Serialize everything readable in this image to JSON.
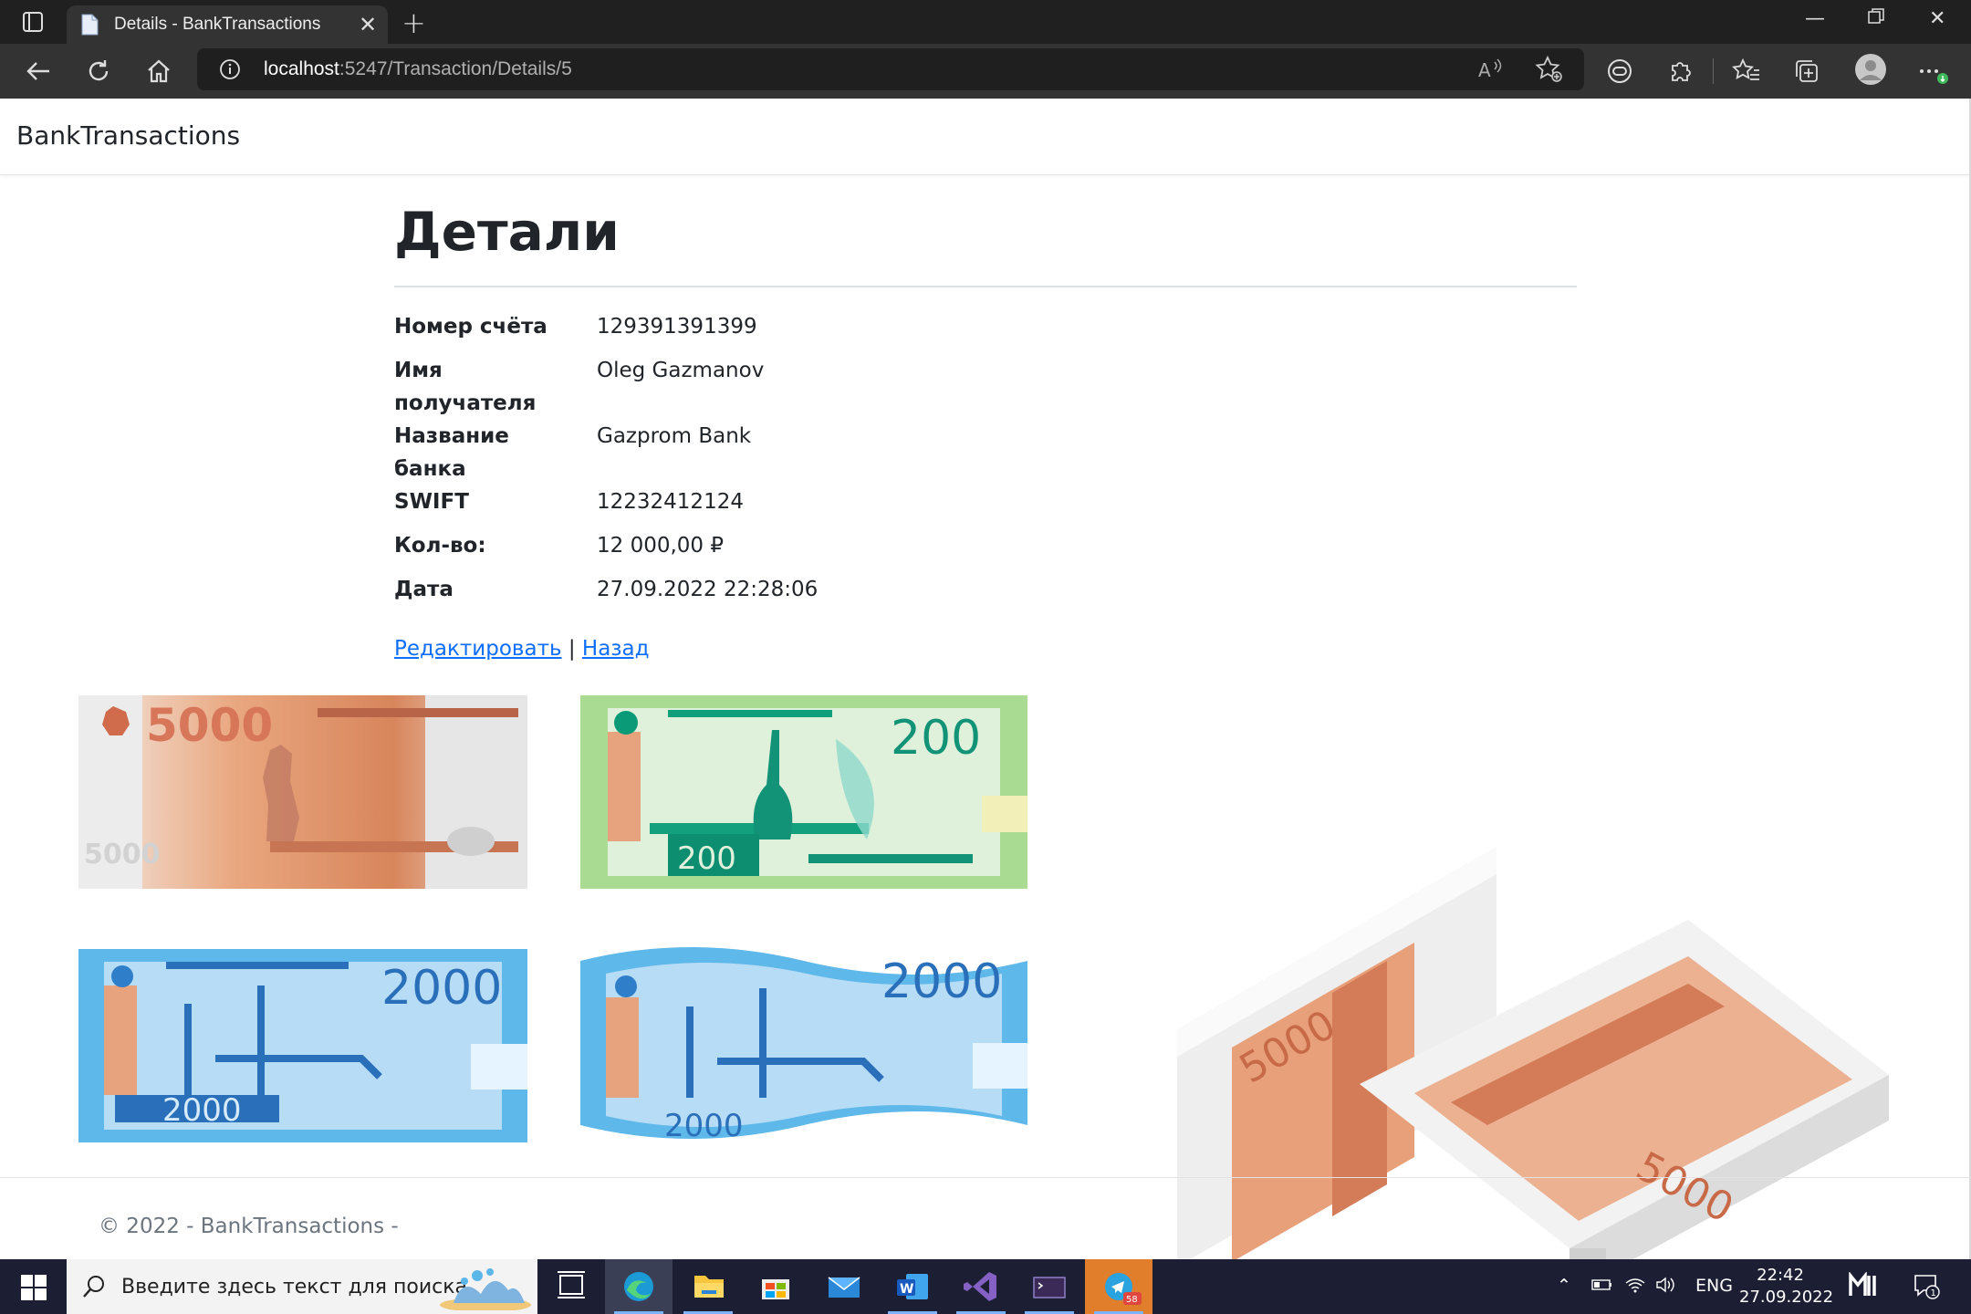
{
  "browser": {
    "tab_title": "Details - BankTransactions",
    "url_host": "localhost",
    "url_rest": ":5247/Transaction/Details/5"
  },
  "site": {
    "brand": "BankTransactions"
  },
  "details": {
    "heading": "Детали",
    "rows": [
      {
        "label": "Номер счёта",
        "value": "129391391399"
      },
      {
        "label": "Имя получателя",
        "value": "Oleg Gazmanov"
      },
      {
        "label": "Название банка",
        "value": "Gazprom Bank"
      },
      {
        "label": "SWIFT",
        "value": "12232412124"
      },
      {
        "label": "Кол-во:",
        "value": "12 000,00 ₽"
      },
      {
        "label": "Дата",
        "value": "27.09.2022 22:28:06"
      }
    ],
    "edit_link": "Редактировать",
    "separator": "|",
    "back_link": "Назад"
  },
  "banknotes": {
    "note1": "5000",
    "note2": "200",
    "note3": "2000",
    "note4": "2000",
    "stack": "5000"
  },
  "footer": {
    "copyright": "© 2022 - BankTransactions -"
  },
  "taskbar": {
    "search_placeholder": "Введите здесь текст для поиска",
    "lang": "ENG",
    "time": "22:42",
    "date": "27.09.2022",
    "telegram_badge": "58",
    "notification_count": "1"
  },
  "colors": {
    "link": "#0d6efd",
    "note5000": "#d9855c",
    "note200": "#4bbf7a",
    "note2000": "#3d9be0"
  }
}
